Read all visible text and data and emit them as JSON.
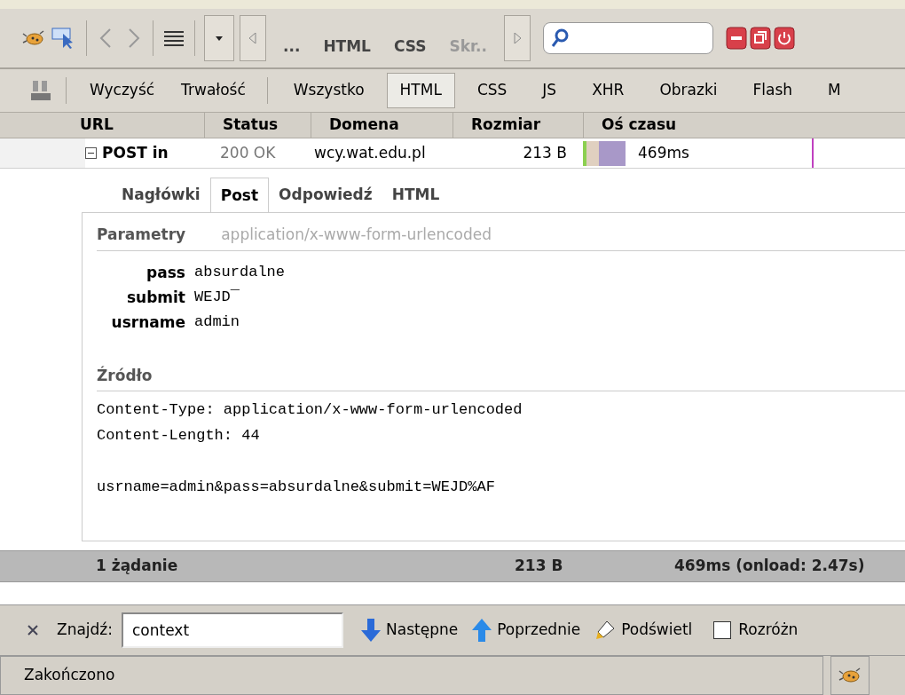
{
  "toolbar": {
    "tabs": [
      {
        "label": "...",
        "selected": false
      },
      {
        "label": "HTML",
        "selected": false
      },
      {
        "label": "CSS",
        "selected": false
      },
      {
        "label": "Skr..",
        "selected": false
      }
    ]
  },
  "filter_bar": {
    "actions": [
      "Wyczyść",
      "Trwałość"
    ],
    "filters": [
      {
        "label": "Wszystko",
        "selected": false
      },
      {
        "label": "HTML",
        "selected": true
      },
      {
        "label": "CSS",
        "selected": false
      },
      {
        "label": "JS",
        "selected": false
      },
      {
        "label": "XHR",
        "selected": false
      },
      {
        "label": "Obrazki",
        "selected": false
      },
      {
        "label": "Flash",
        "selected": false
      },
      {
        "label": "M",
        "selected": false
      }
    ]
  },
  "table": {
    "columns": [
      "URL",
      "Status",
      "Domena",
      "Rozmiar",
      "Oś czasu"
    ],
    "rows": [
      {
        "url": "POST in",
        "status": "200 OK",
        "domain": "wcy.wat.edu.pl",
        "size": "213 B",
        "time": "469ms",
        "expanded": true
      }
    ]
  },
  "detail": {
    "tabs": [
      {
        "label": "Nagłówki",
        "selected": false
      },
      {
        "label": "Post",
        "selected": true
      },
      {
        "label": "Odpowiedź",
        "selected": false
      },
      {
        "label": "HTML",
        "selected": false
      }
    ],
    "params_title": "Parametry",
    "content_type": "application/x-www-form-urlencoded",
    "params": [
      {
        "name": "pass",
        "value": "absurdalne"
      },
      {
        "name": "submit",
        "value": "WEJD¯"
      },
      {
        "name": "usrname",
        "value": "admin"
      }
    ],
    "source_title": "Źródło",
    "source_headers": [
      "Content-Type: application/x-www-form-urlencoded",
      "Content-Length: 44"
    ],
    "source_body": "usrname=admin&pass=absurdalne&submit=WEJD%AF"
  },
  "summary": {
    "count": "1 żądanie",
    "size": "213 B",
    "time": "469ms (onload: 2.47s)"
  },
  "find_bar": {
    "label": "Znajdź:",
    "value": "context",
    "next": "Następne",
    "previous": "Poprzednie",
    "highlight": "Podświetl",
    "match_case": {
      "label": "Rozróżn",
      "checked": false
    }
  },
  "status_bar": {
    "text": "Zakończono"
  }
}
